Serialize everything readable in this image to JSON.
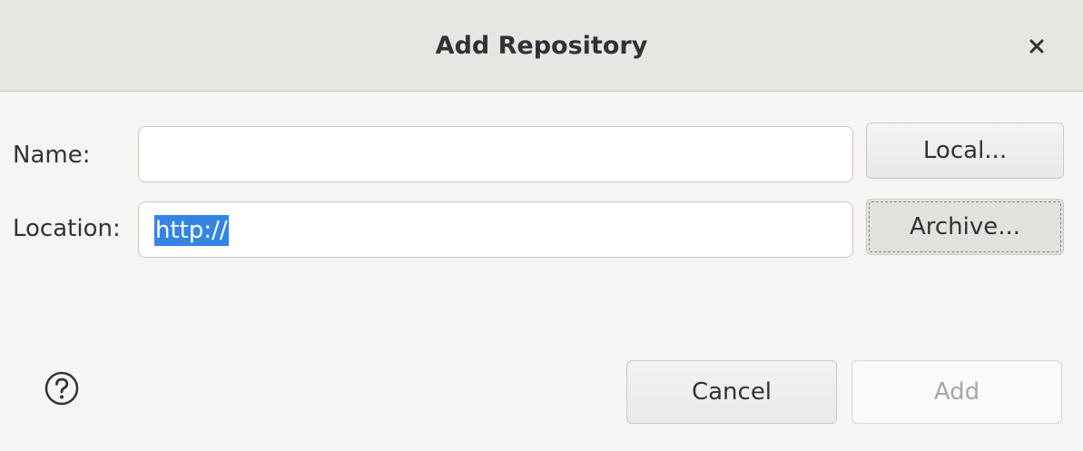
{
  "dialog": {
    "title": "Add Repository",
    "close_icon": "close-icon"
  },
  "form": {
    "name_label": "Name:",
    "name_value": "",
    "location_label": "Location:",
    "location_value": "http://"
  },
  "buttons": {
    "local": "Local...",
    "archive": "Archive...",
    "cancel": "Cancel",
    "add": "Add"
  },
  "help_icon": "help-icon",
  "colors": {
    "selection": "#3584e4",
    "titlebar": "#e8e6e3",
    "background": "#f6f5f4"
  }
}
